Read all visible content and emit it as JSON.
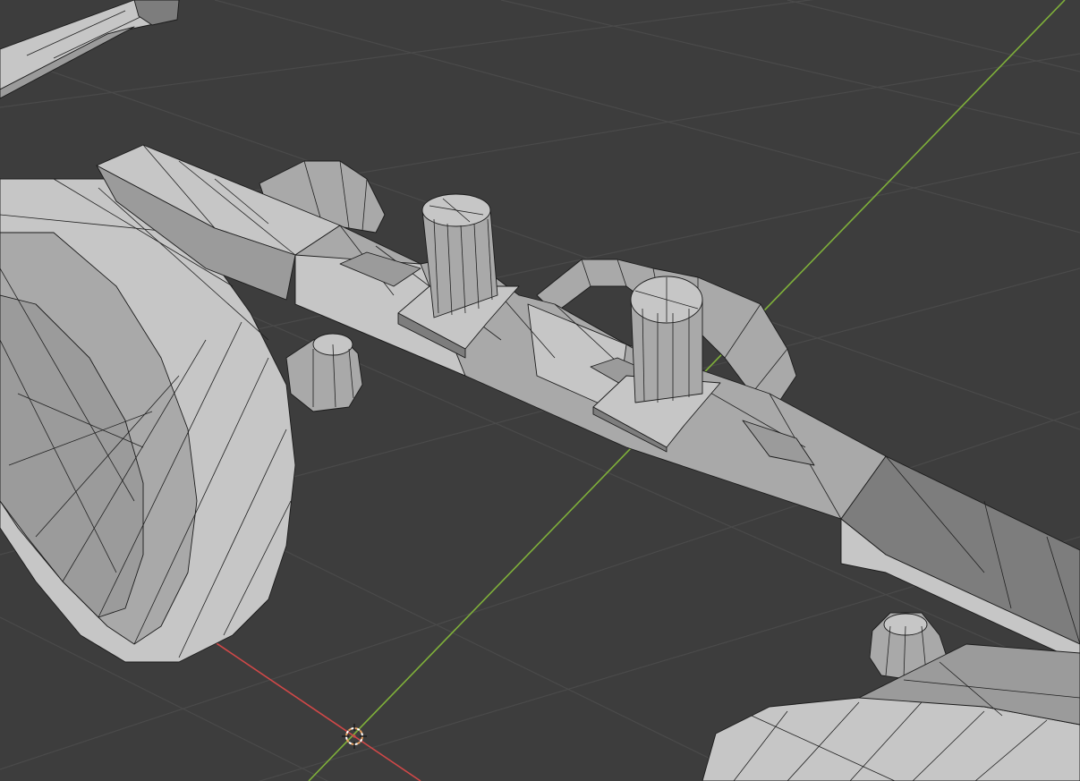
{
  "viewport": {
    "background_color": "#3d3d3d",
    "grid_color": "#4a4a4a",
    "x_axis_color": "#d04848",
    "y_axis_color": "#7fb03a",
    "mesh_color": "#b3b3b3",
    "wire_color": "#1b1b1b",
    "cursor_color": "#e8a060"
  },
  "objects": [
    {
      "name": "axle-beam"
    },
    {
      "name": "kingpin-left"
    },
    {
      "name": "kingpin-right"
    },
    {
      "name": "wheel-left"
    },
    {
      "name": "wheel-right-partial"
    },
    {
      "name": "steering-arm"
    },
    {
      "name": "bolt-left"
    },
    {
      "name": "bolt-right"
    },
    {
      "name": "strut-top-left"
    }
  ],
  "cursor": {
    "icon": "3d-cursor-icon"
  }
}
